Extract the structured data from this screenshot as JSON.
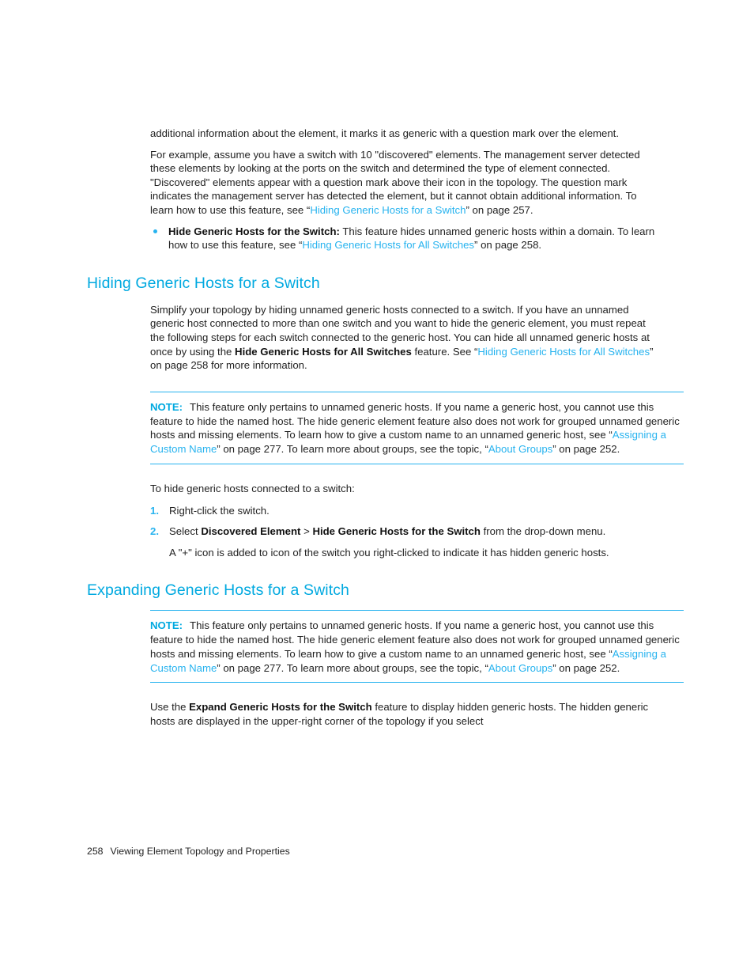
{
  "document": {
    "page_number": "258",
    "footer_title": "Viewing Element Topology and Properties"
  },
  "intro": {
    "para1": "additional information about the element, it marks it as generic with a question mark over the element.",
    "para2_a": "For example, assume you have a switch with 10 \"discovered\" elements. The management server detected these elements by looking at the ports on the switch and determined the type of element connected. \"Discovered\" elements appear with a question mark above their icon in the topology. The question mark indicates the management server has detected the element, but it cannot obtain additional information. To learn how to use this feature, see “",
    "para2_link": "Hiding Generic Hosts for a Switch",
    "para2_b": "” on page 257."
  },
  "bullet": {
    "term": "Hide Generic Hosts for the Switch:",
    "text_a": " This feature hides unnamed generic hosts within a domain. To learn how to use this feature, see “",
    "link": "Hiding Generic Hosts for All Switches",
    "text_b": "” on page 258."
  },
  "section_hiding": {
    "heading": "Hiding Generic Hosts for a Switch",
    "para_a": "Simplify your topology by hiding unnamed generic hosts connected to a switch. If you have an unnamed generic host connected to more than one switch and you want to hide the generic element, you must repeat the following steps for each switch connected to the generic host. You can hide all unnamed generic hosts at once by using the ",
    "para_bold": "Hide Generic Hosts for All Switches",
    "para_b": " feature. See “",
    "para_link": "Hiding Generic Hosts for All Switches",
    "para_c": "” on page 258 for more information."
  },
  "note": {
    "label": "NOTE:",
    "text_a": "This feature only pertains to unnamed generic hosts. If you name a generic host, you cannot use this feature to hide the named host. The hide generic element feature also does not work for grouped unnamed generic hosts and missing elements. To learn how to give a custom name to an unnamed generic host, see “",
    "link1": "Assigning a Custom Name",
    "text_b": "” on page 277. To learn more about groups, see the topic, “",
    "link2": "About Groups",
    "text_c": "” on page 252."
  },
  "procedure": {
    "lead_in": "To hide generic hosts connected to a switch:",
    "step1_num": "1.",
    "step1_text": "Right-click the switch.",
    "step2_num": "2.",
    "step2_a": "Select ",
    "step2_bold1": "Discovered Element",
    "step2_b": " > ",
    "step2_bold2": "Hide Generic Hosts for the Switch",
    "step2_c": " from the drop-down menu.",
    "step2_sub": "A \"+\" icon is added to icon of the switch you right-clicked to indicate it has hidden generic hosts."
  },
  "section_expanding": {
    "heading": "Expanding Generic Hosts for a Switch",
    "para_a": "Use the ",
    "para_bold": "Expand Generic Hosts for the Switch",
    "para_b": " feature to display hidden generic hosts. The hidden generic hosts are displayed in the upper-right corner of the topology if you select"
  },
  "colors": {
    "accent_cyan": "#00a9e0",
    "link_cyan": "#27b3ef",
    "text": "#222222"
  }
}
